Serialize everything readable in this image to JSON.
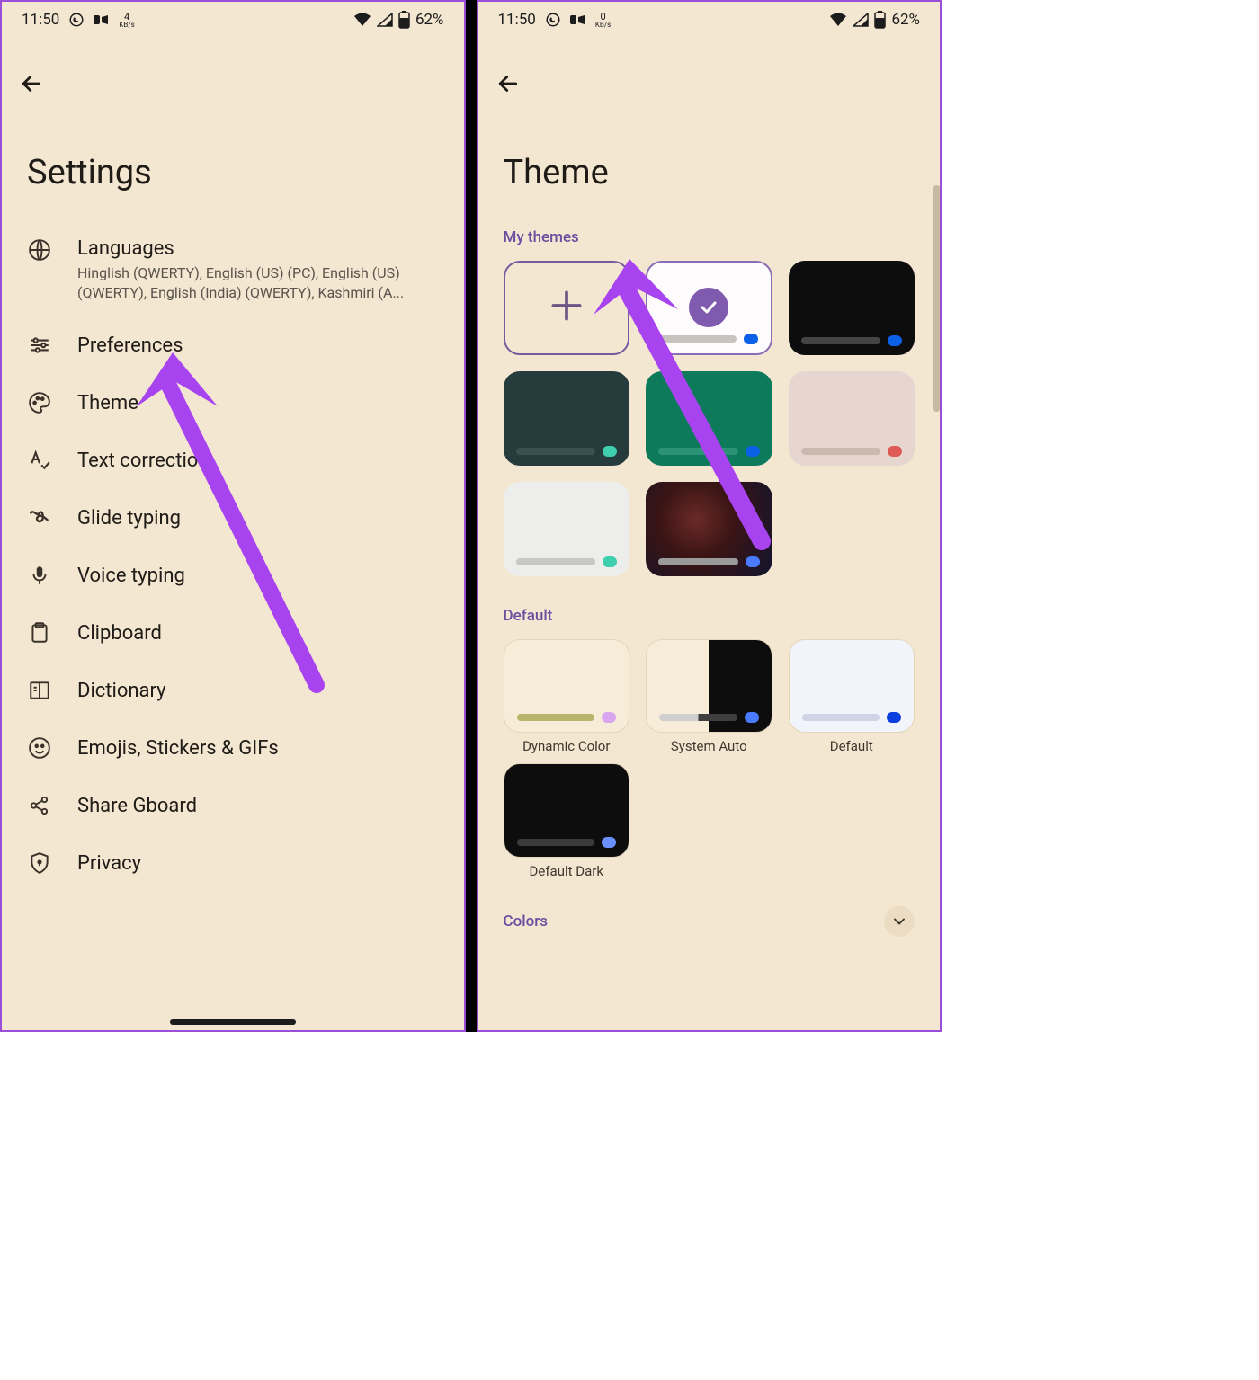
{
  "status": {
    "time": "11:50",
    "kb_speed_left": "4",
    "kb_speed_right": "0",
    "kb_unit": "KB/s",
    "battery": "62%"
  },
  "settings_page": {
    "title": "Settings",
    "items": [
      {
        "label": "Languages",
        "sub": "Hinglish (QWERTY), English (US) (PC), English (US) (QWERTY), English (India) (QWERTY), Kashmiri (A..."
      },
      {
        "label": "Preferences"
      },
      {
        "label": "Theme"
      },
      {
        "label": "Text correction"
      },
      {
        "label": "Glide typing"
      },
      {
        "label": "Voice typing"
      },
      {
        "label": "Clipboard"
      },
      {
        "label": "Dictionary"
      },
      {
        "label": "Emojis, Stickers & GIFs"
      },
      {
        "label": "Share Gboard"
      },
      {
        "label": "Privacy"
      }
    ]
  },
  "theme_page": {
    "title": "Theme",
    "sections": {
      "my_themes": "My themes",
      "default": "Default",
      "colors": "Colors"
    },
    "my_themes": [
      {
        "type": "add"
      },
      {
        "type": "selected",
        "bg": "#fdfbfb",
        "dot": "#0b60e8"
      },
      {
        "bg": "#0d0d0d",
        "dot": "#0b60e8",
        "bar": "#444"
      },
      {
        "bg": "#263b3b",
        "dot": "#3fcfae",
        "bar": "#3b5050"
      },
      {
        "bg": "#0d7a5c",
        "dot": "#0b60e8",
        "bar": "#2b9276"
      },
      {
        "bg": "#e7d6cf",
        "dot": "#e05a55",
        "bar": "#cbb9b0"
      },
      {
        "bg": "#edeeec",
        "dot": "#3fcfae",
        "bar": "#c6c8c5"
      },
      {
        "type": "photo",
        "dot": "#4a7aff",
        "bar": "#8b8b8b"
      }
    ],
    "default": [
      {
        "label": "Dynamic Color",
        "bg": "#f6ecd8",
        "dot": "#d9a6f0",
        "bar": "#b9b56c"
      },
      {
        "label": "System Auto",
        "left": "#f6ecd8",
        "right": "#0d0d0d",
        "dot": "#4a7aff",
        "bar_l": "#cfcfcf",
        "bar_r": "#3f3f3f"
      },
      {
        "label": "Default",
        "bg": "#f2f4fb",
        "dot": "#0b3fe0",
        "bar": "#cfd4e6"
      },
      {
        "label": "Default Dark",
        "bg": "#0d0d0d",
        "dot": "#6a8fff",
        "bar": "#3a3a3a"
      }
    ]
  }
}
